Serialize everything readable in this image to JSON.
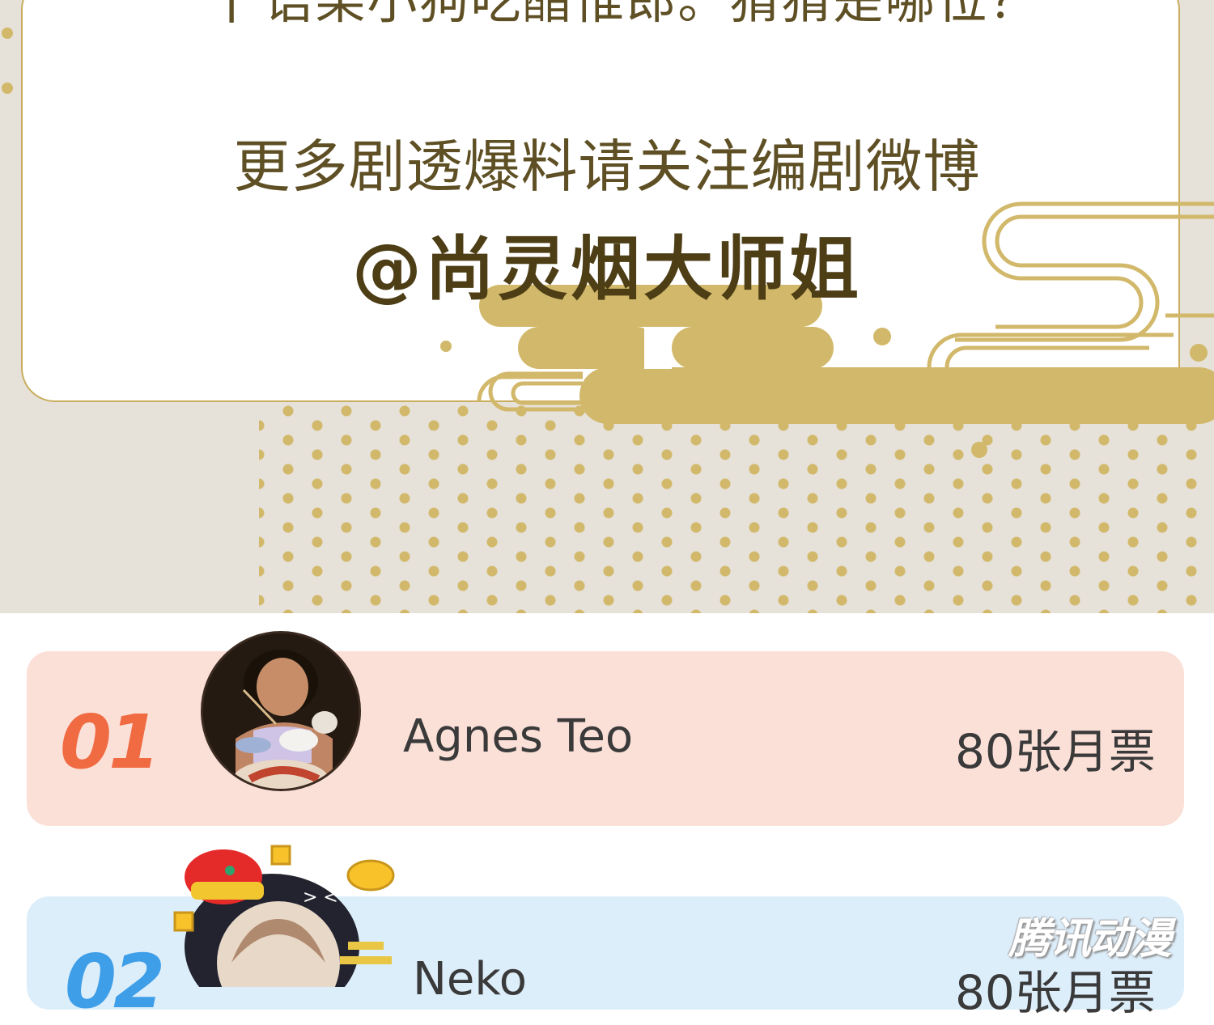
{
  "banner": {
    "top_line": "† 语某小狗吃醋惟郎。猜猜是哪位？",
    "promo_text": "更多剧透爆料请关注编剧微博",
    "weibo_handle": "@尚灵烟大师姐",
    "colors": {
      "gold": "#d2b86a",
      "text_brown": "#5e4f24",
      "background": "#e6e2da"
    }
  },
  "leaderboard": {
    "entries": [
      {
        "rank": "01",
        "name": "Agnes Teo",
        "votes": "80张月票",
        "color": "#f06a42",
        "card_color": "#fbe0d8"
      },
      {
        "rank": "02",
        "name": "Neko",
        "votes": "80张月票",
        "color": "#3e9ee8",
        "card_color": "#ddeefb"
      }
    ]
  },
  "watermark": {
    "text": "腾讯动漫"
  }
}
